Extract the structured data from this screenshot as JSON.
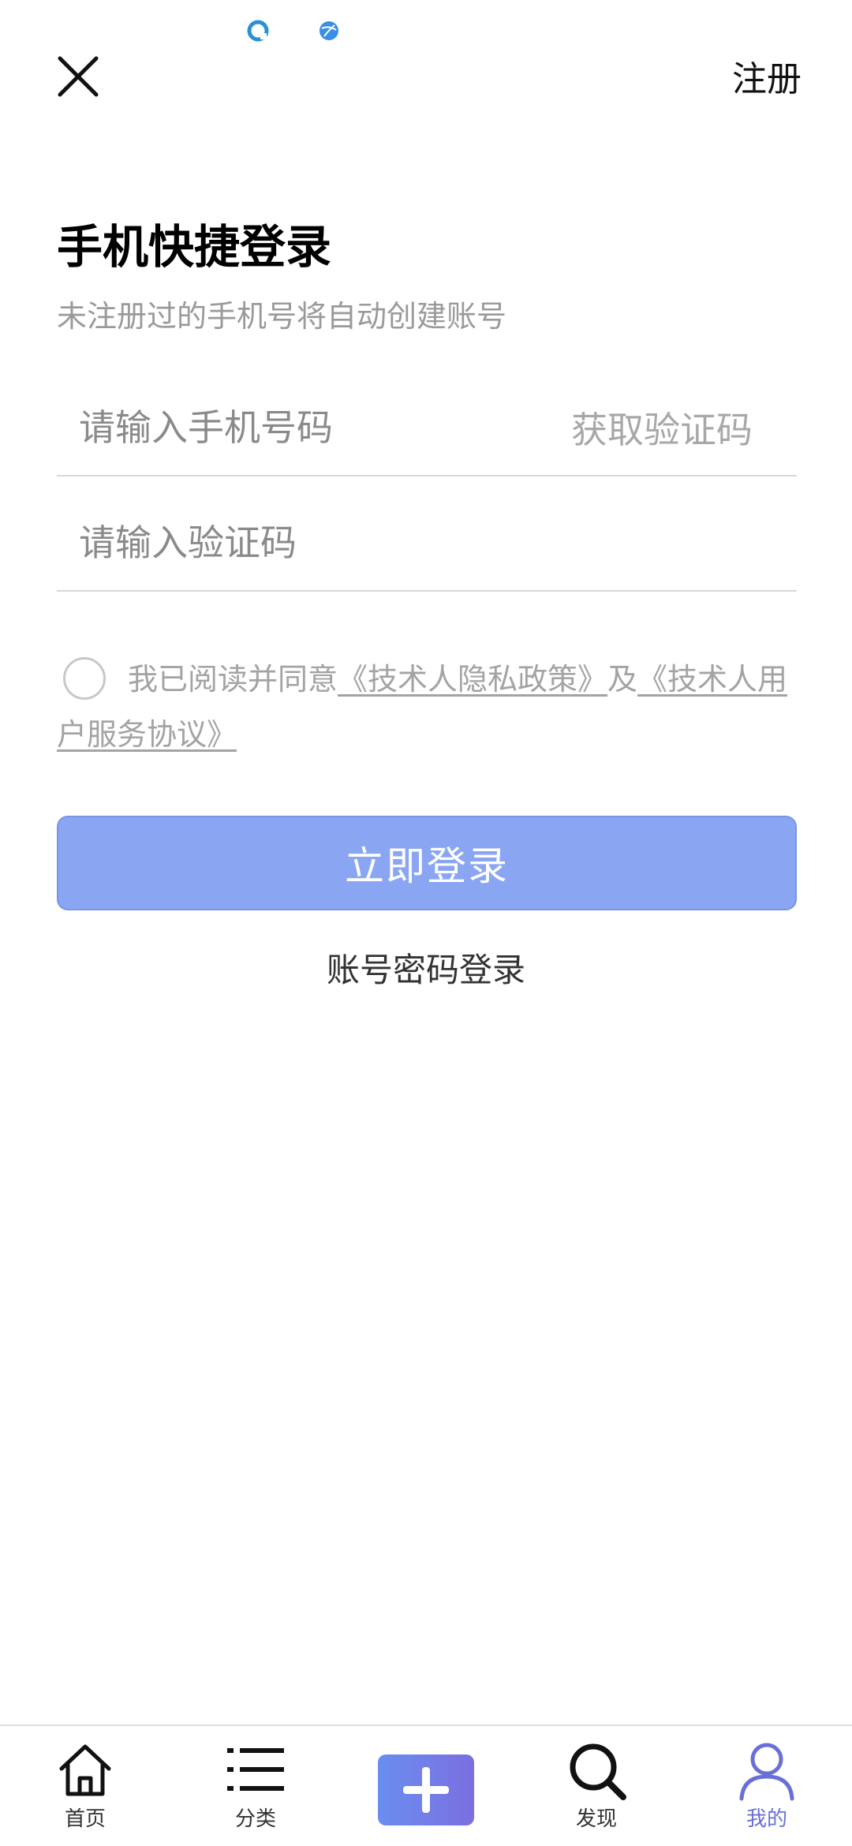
{
  "header": {
    "register_label": "注册"
  },
  "login": {
    "title": "手机快捷登录",
    "subtitle": "未注册过的手机号将自动创建账号",
    "phone_placeholder": "请输入手机号码",
    "get_code_label": "获取验证码",
    "code_placeholder": "请输入验证码",
    "agreement": {
      "prefix": "我已阅读并同意",
      "privacy_link": "《技术人隐私政策》",
      "joiner": "及",
      "terms_link": "《技术人用户服务协议》"
    },
    "submit_label": "立即登录",
    "password_login_label": "账号密码登录"
  },
  "bottom_nav": {
    "items": [
      {
        "label": "首页",
        "icon": "home-icon"
      },
      {
        "label": "分类",
        "icon": "list-icon"
      },
      {
        "label": "",
        "icon": "plus-icon"
      },
      {
        "label": "发现",
        "icon": "search-icon"
      },
      {
        "label": "我的",
        "icon": "user-icon"
      }
    ],
    "active_index": 4
  },
  "colors": {
    "primary_button": "#8aa6f3",
    "active_nav": "#6a6fd8",
    "muted_text": "#9a9a9a"
  }
}
